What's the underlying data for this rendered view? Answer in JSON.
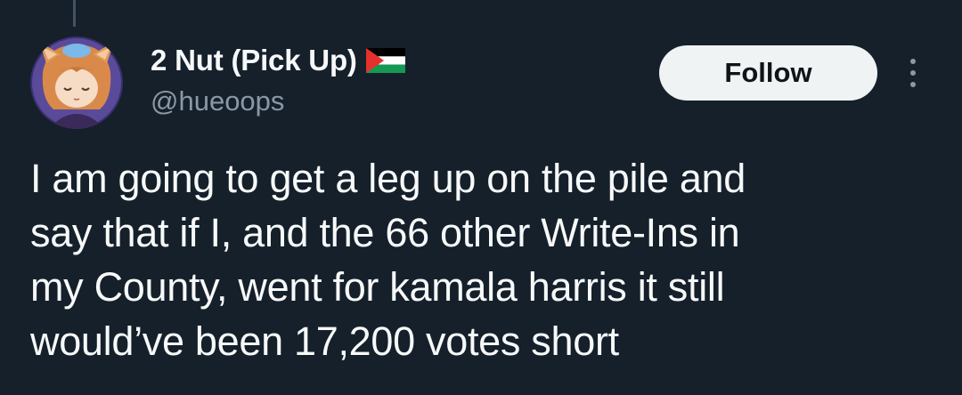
{
  "author": {
    "display_name": "2 Nut (Pick Up)",
    "handle": "@hueoops",
    "flag_icon": "palestine-flag-icon",
    "avatar_icon": "anime-character-avatar"
  },
  "actions": {
    "follow_label": "Follow",
    "more_icon": "more-options-icon"
  },
  "tweet": {
    "lines": [
      "I am going to get a leg up on the pile and",
      "say that if I, and the 66 other Write-Ins in",
      "my County, went for kamala harris it still",
      "would’ve been 17,200 votes short"
    ]
  },
  "colors": {
    "background": "#15202b",
    "primary_text": "#f7f9f9",
    "secondary_text": "#8b98a5",
    "follow_button_bg": "#eff3f4",
    "follow_button_text": "#0f1419",
    "thread_line": "#425364"
  }
}
